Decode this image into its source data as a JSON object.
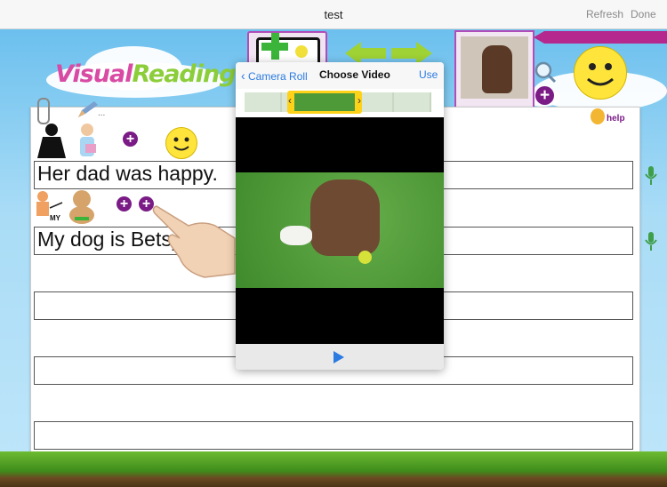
{
  "topbar": {
    "title": "test",
    "refresh": "Refresh",
    "done": "Done"
  },
  "logo": {
    "part1": "Visual",
    "part2": "Reading"
  },
  "help": {
    "label": "help"
  },
  "lines": [
    {
      "text": "Her dad was happy."
    },
    {
      "text": "My dog is Betsy"
    },
    {
      "text": ""
    },
    {
      "text": ""
    },
    {
      "text": ""
    }
  ],
  "symbols": {
    "my_label": "MY"
  },
  "popover": {
    "back": "Camera Roll",
    "title": "Choose Video",
    "use": "Use"
  },
  "colors": {
    "plus": "#7a1b86",
    "link": "#2a7ae2",
    "smiley": "#ffe53b"
  }
}
